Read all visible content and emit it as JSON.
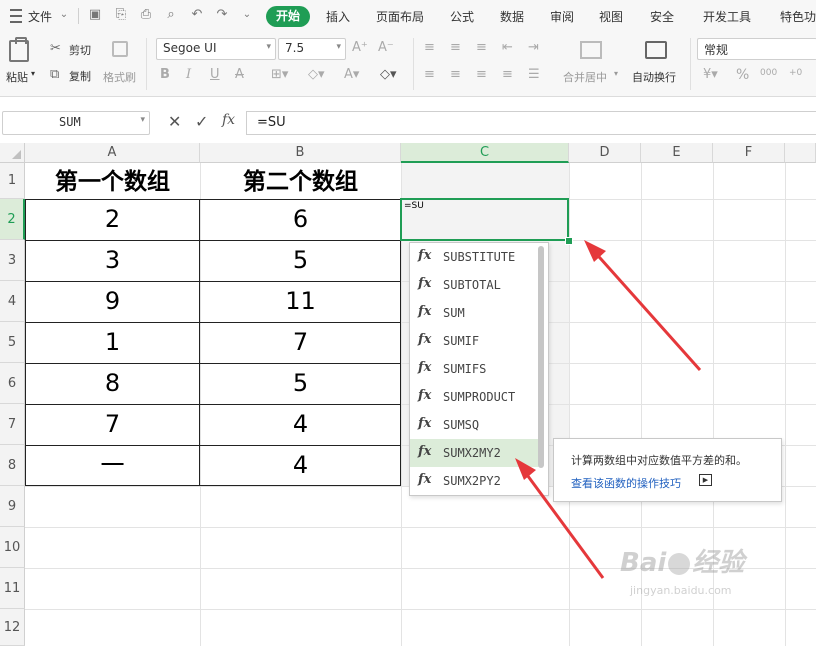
{
  "menubar": {
    "file_label": "文件",
    "tabs": [
      "开始",
      "插入",
      "页面布局",
      "公式",
      "数据",
      "审阅",
      "视图",
      "安全",
      "开发工具",
      "特色功"
    ],
    "active_tab": "开始"
  },
  "ribbon": {
    "paste_label": "粘贴",
    "cut_label": "剪切",
    "copy_label": "复制",
    "format_painter_label": "格式刷",
    "font_name": "Segoe UI",
    "font_size": "7.5",
    "merge_center_label": "合并居中",
    "wrap_text_label": "自动换行",
    "number_format": "常规"
  },
  "formula_bar": {
    "name_box": "SUM",
    "fx_label": "fx",
    "formula": "=SU"
  },
  "columns": [
    "A",
    "B",
    "C",
    "D",
    "E",
    "F"
  ],
  "rows": [
    "1",
    "2",
    "3",
    "4",
    "5",
    "6",
    "7",
    "8",
    "9",
    "10",
    "11",
    "12"
  ],
  "sheet": {
    "header": [
      "第一个数组",
      "第二个数组"
    ],
    "data": [
      [
        "2",
        "6"
      ],
      [
        "3",
        "5"
      ],
      [
        "9",
        "11"
      ],
      [
        "1",
        "7"
      ],
      [
        "8",
        "5"
      ],
      [
        "7",
        "4"
      ],
      [
        "一",
        "4"
      ]
    ],
    "active_cell_text": "=SU"
  },
  "autocomplete": {
    "items": [
      "SUBSTITUTE",
      "SUBTOTAL",
      "SUM",
      "SUMIF",
      "SUMIFS",
      "SUMPRODUCT",
      "SUMSQ",
      "SUMX2MY2",
      "SUMX2PY2"
    ],
    "selected": "SUMX2MY2"
  },
  "tooltip": {
    "description": "计算两数组中对应数值平方差的和。",
    "link": "查看该函数的操作技巧"
  },
  "watermark": {
    "brand": "Bai经验",
    "url": "jingyan.baidu.com"
  },
  "colors": {
    "accent_green": "#1f9d55",
    "annotation_red": "#e5383b",
    "selection_green": "#dcecd9",
    "link_blue": "#1f5fbf"
  }
}
